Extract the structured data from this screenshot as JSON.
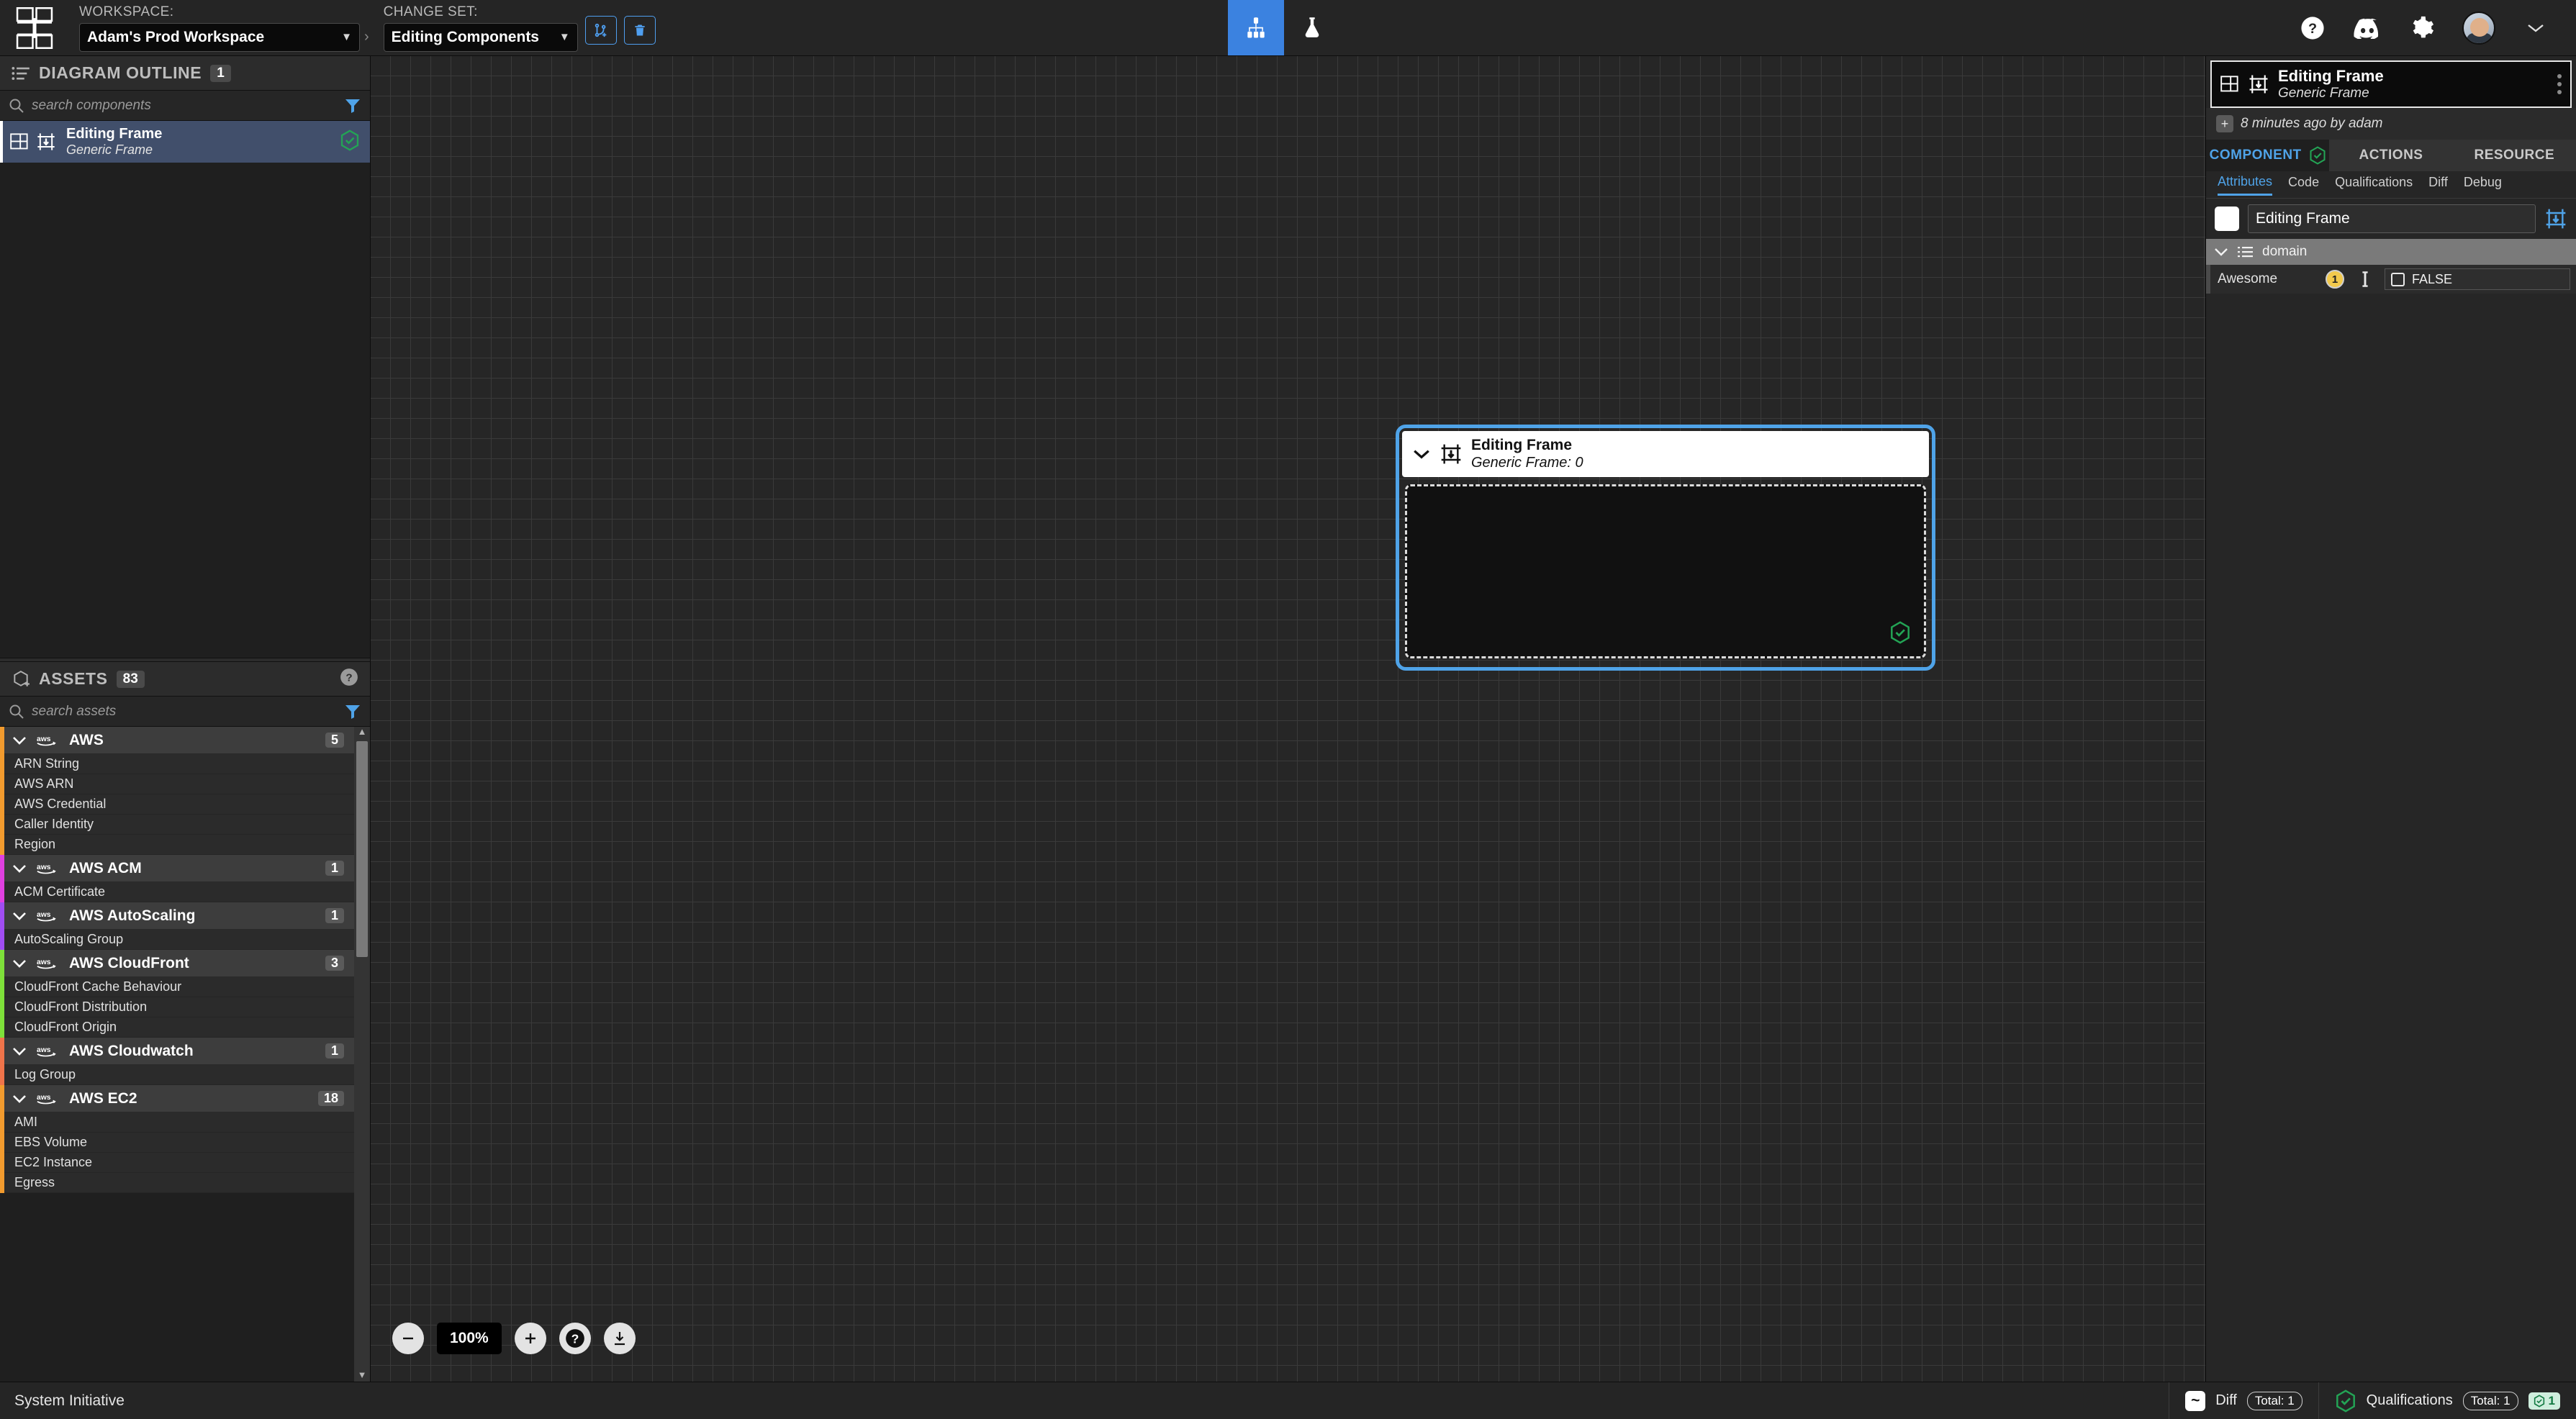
{
  "header": {
    "logo_name": "system-initiative-logo",
    "workspace_label": "WORKSPACE:",
    "workspace_value": "Adam's Prod Workspace",
    "changeset_label": "CHANGE SET:",
    "changeset_value": "Editing Components",
    "breadcrumb_sep": "›",
    "caret": "▼",
    "create_changeset_icon": "branch-plus-icon",
    "delete_changeset_icon": "trash-icon",
    "tab_diagram_icon": "diagram-hierarchy-icon",
    "tab_lab_icon": "flask-icon",
    "help_icon": "question-circle-icon",
    "discord_icon": "discord-icon",
    "settings_icon": "gear-icon",
    "avatar_name": "user-avatar",
    "profile_caret": "⌄"
  },
  "outline": {
    "title": "DIAGRAM OUTLINE",
    "count": "1",
    "list_icon": "bullet-list-icon",
    "search_placeholder": "search components",
    "search_value": "",
    "search_icon": "search-icon",
    "filter_icon": "filter-icon",
    "items": [
      {
        "name": "Editing Frame",
        "subtitle": "Generic Frame",
        "status_icon": "qualification-check-icon"
      }
    ]
  },
  "assets": {
    "title": "ASSETS",
    "count": "83",
    "cube_icon": "cube-plus-icon",
    "help_icon": "question-circle-icon",
    "search_placeholder": "search assets",
    "search_value": "",
    "search_icon": "search-icon",
    "filter_icon": "filter-icon",
    "chevron": "❯",
    "groups": [
      {
        "name": "AWS",
        "count": "5",
        "accent": "#f29b2e",
        "vendor_icon": "aws-logo-icon",
        "items": [
          "ARN String",
          "AWS ARN",
          "AWS Credential",
          "Caller Identity",
          "Region"
        ]
      },
      {
        "name": "AWS ACM",
        "count": "1",
        "accent": "#e040e0",
        "vendor_icon": "aws-logo-icon",
        "items": [
          "ACM Certificate"
        ]
      },
      {
        "name": "AWS AutoScaling",
        "count": "1",
        "accent": "#a04df2",
        "vendor_icon": "aws-logo-icon",
        "items": [
          "AutoScaling Group"
        ]
      },
      {
        "name": "AWS CloudFront",
        "count": "3",
        "accent": "#7ee03a",
        "vendor_icon": "aws-logo-icon",
        "items": [
          "CloudFront Cache Behaviour",
          "CloudFront Distribution",
          "CloudFront Origin"
        ]
      },
      {
        "name": "AWS Cloudwatch",
        "count": "1",
        "accent": "#f0744a",
        "vendor_icon": "aws-logo-icon",
        "items": [
          "Log Group"
        ]
      },
      {
        "name": "AWS EC2",
        "count": "18",
        "accent": "#f29b2e",
        "vendor_icon": "aws-logo-icon",
        "items": [
          "AMI",
          "EBS Volume",
          "EC2 Instance",
          "Egress"
        ]
      }
    ]
  },
  "canvas": {
    "frame": {
      "name": "Editing Frame",
      "subtitle": "Generic Frame: 0",
      "collapse_icon": "chevron-down-icon",
      "frame_icon": "frame-down-arrow-icon",
      "status_icon": "qualification-check-icon"
    },
    "zoom": {
      "out_label": "−",
      "value": "100%",
      "in_label": "+",
      "help_icon": "question-circle-icon",
      "download_icon": "download-icon"
    }
  },
  "component_panel": {
    "title": "Editing Frame",
    "subtitle": "Generic Frame",
    "panel_icon": "component-frame-icon",
    "menu_icon": "kebab-menu-icon",
    "meta_text": "8 minutes ago by adam",
    "meta_badge": "+",
    "top_tabs": [
      {
        "label": "COMPONENT",
        "active": true,
        "status_icon": "qualification-check-icon"
      },
      {
        "label": "ACTIONS",
        "active": false
      },
      {
        "label": "RESOURCE",
        "active": false
      }
    ],
    "sub_tabs": [
      {
        "label": "Attributes",
        "active": true
      },
      {
        "label": "Code",
        "active": false
      },
      {
        "label": "Qualifications",
        "active": false
      },
      {
        "label": "Diff",
        "active": false
      },
      {
        "label": "Debug",
        "active": false
      }
    ],
    "name_field": {
      "value": "Editing Frame",
      "swatch_color": "#ffffff",
      "frame_icon": "frame-down-arrow-icon"
    },
    "domain": {
      "label": "domain",
      "expand_icon": "chevron-down-icon",
      "list_icon": "list-icon"
    },
    "attributes": [
      {
        "name": "Awesome",
        "badge": "1",
        "badge_color": "#f2c94c",
        "input_icon": "text-cursor-icon",
        "value": "FALSE",
        "checked": false
      }
    ]
  },
  "status_bar": {
    "brand": "System Initiative",
    "diff": {
      "icon": "diff-wave-icon",
      "label": "Diff",
      "total": "Total: 1"
    },
    "qualifications": {
      "icon": "qualification-check-icon",
      "label": "Qualifications",
      "total": "Total: 1",
      "passed": "1"
    }
  },
  "colors": {
    "accent_blue": "#4fa3e8",
    "selection_blue": "#414f6b",
    "success_green": "#23a455",
    "warning_yellow": "#f2c94c",
    "canvas_bg": "#262626",
    "grid_line": "#3a3a3a"
  }
}
